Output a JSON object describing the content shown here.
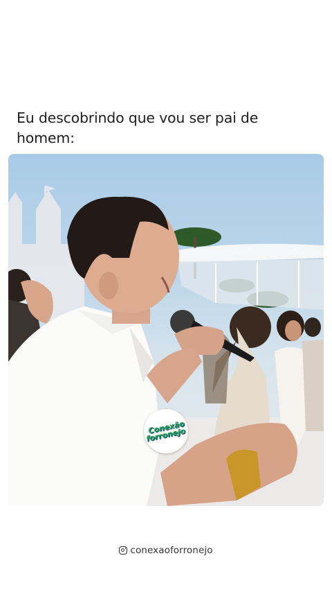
{
  "post": {
    "caption": "Eu descobrindo que vou ser pai de homem:",
    "badge_line1": "Conexão",
    "badge_line2": "forronejo",
    "footer_handle": "conexaoforronejo",
    "footer_icon": "instagram-icon"
  },
  "colors": {
    "background": "#ffffff",
    "caption_text": "#1e1e1e",
    "badge_green": "#1fa84a",
    "badge_blue": "#1c3f8a"
  }
}
